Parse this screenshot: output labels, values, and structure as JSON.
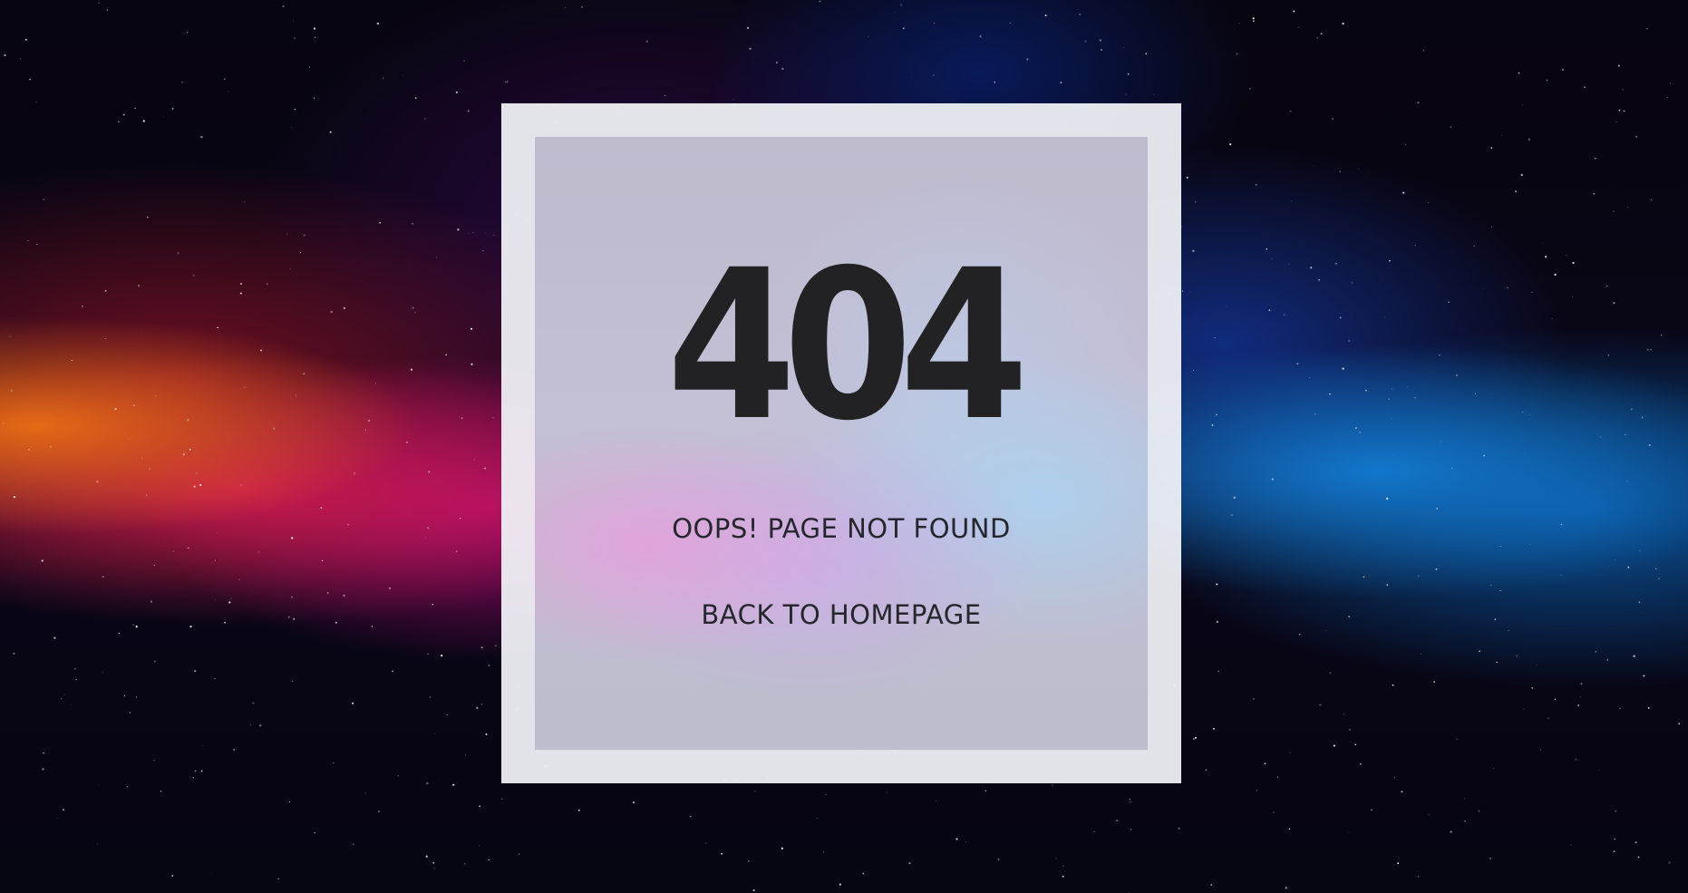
{
  "error": {
    "code": "404",
    "message": "OOPS! PAGE NOT FOUND",
    "home_link_label": "BACK TO HOMEPAGE"
  },
  "colors": {
    "text": "#222224",
    "frame": "#f0f1f6"
  }
}
